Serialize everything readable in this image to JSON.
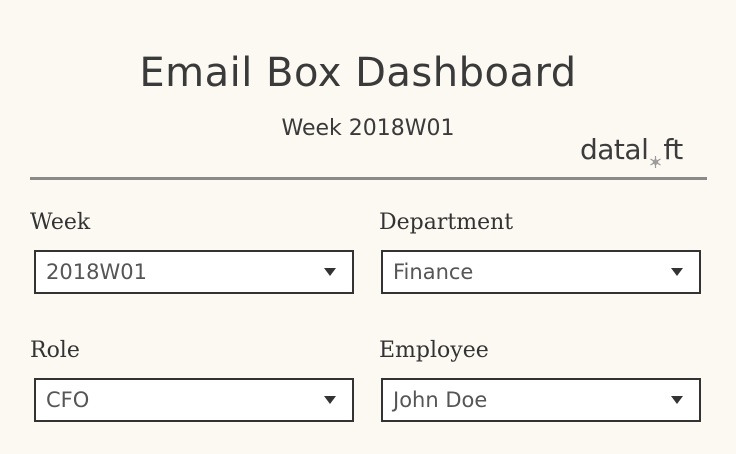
{
  "header": {
    "title": "Email Box Dashboard",
    "subtitle": "Week 2018W01",
    "logo_left": "datal",
    "logo_right": "ft"
  },
  "filters": {
    "week": {
      "label": "Week",
      "value": "2018W01"
    },
    "department": {
      "label": "Department",
      "value": "Finance"
    },
    "role": {
      "label": "Role",
      "value": "CFO"
    },
    "employee": {
      "label": "Employee",
      "value": "John Doe"
    }
  },
  "colors": {
    "background": "#fcf8f2",
    "text": "#333333",
    "divider": "#8a8a8a",
    "field_border": "#333333"
  }
}
